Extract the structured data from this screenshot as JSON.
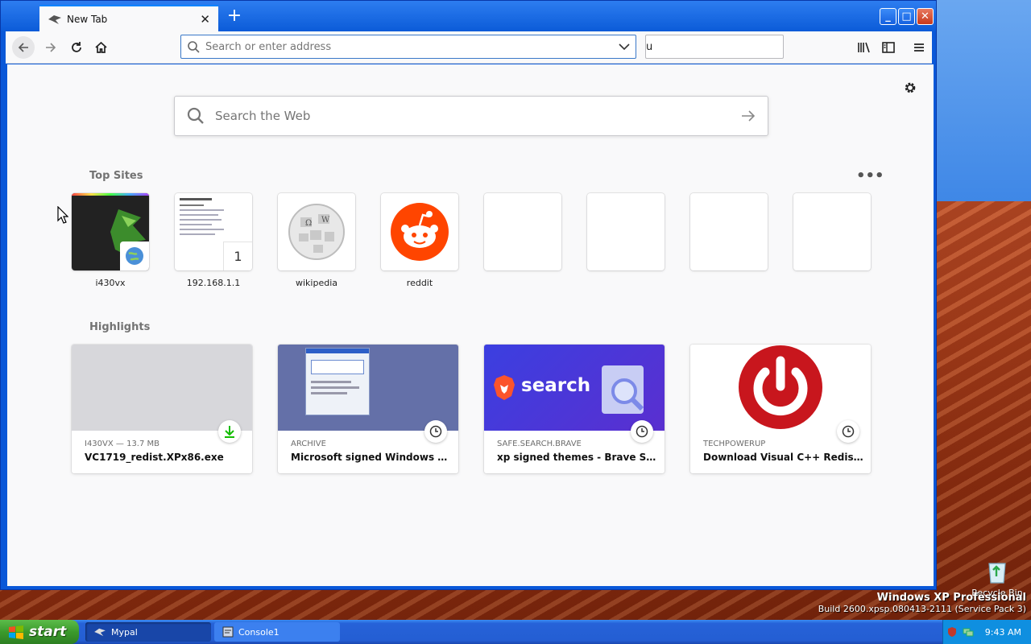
{
  "browser": {
    "tab_title": "New Tab",
    "url_placeholder": "Search or enter address",
    "searchbar_value": "u"
  },
  "newtab": {
    "web_search_placeholder": "Search the Web",
    "top_sites_title": "Top Sites",
    "highlights_title": "Highlights",
    "top_sites": [
      {
        "label": "i430vx"
      },
      {
        "label": "192.168.1.1",
        "badge": "1"
      },
      {
        "label": "wikipedia"
      },
      {
        "label": "reddit"
      },
      {
        "label": ""
      },
      {
        "label": ""
      },
      {
        "label": ""
      },
      {
        "label": ""
      }
    ],
    "highlights": [
      {
        "meta": "I430VX — 13.7 MB",
        "title": "VC1719_redist.XPx86.exe",
        "badge_icon": "download-icon"
      },
      {
        "meta": "ARCHIVE",
        "title": "Microsoft signed Windows XP T...",
        "badge_icon": "clock-icon"
      },
      {
        "meta": "SAFE.SEARCH.BRAVE",
        "title": "xp signed themes - Brave Search",
        "badge_icon": "clock-icon",
        "image_text": "search"
      },
      {
        "meta": "TECHPOWERUP",
        "title": "Download Visual C++ Redistribu...",
        "badge_icon": "clock-icon"
      }
    ]
  },
  "desktop": {
    "recycle_bin_label": "Recycle Bin",
    "brand_line1": "Windows XP Professional",
    "brand_line2": "Build 2600.xpsp.080413-2111 (Service Pack 3)"
  },
  "taskbar": {
    "start_label": "start",
    "tasks": [
      {
        "label": "Mypal"
      },
      {
        "label": "Console1"
      }
    ],
    "clock": "9:43 AM"
  },
  "colors": {
    "accent": "#0a84ff",
    "reddit": "#ff4500",
    "brave_bg": "#3b3fe0",
    "techpowerup": "#c8161d"
  }
}
